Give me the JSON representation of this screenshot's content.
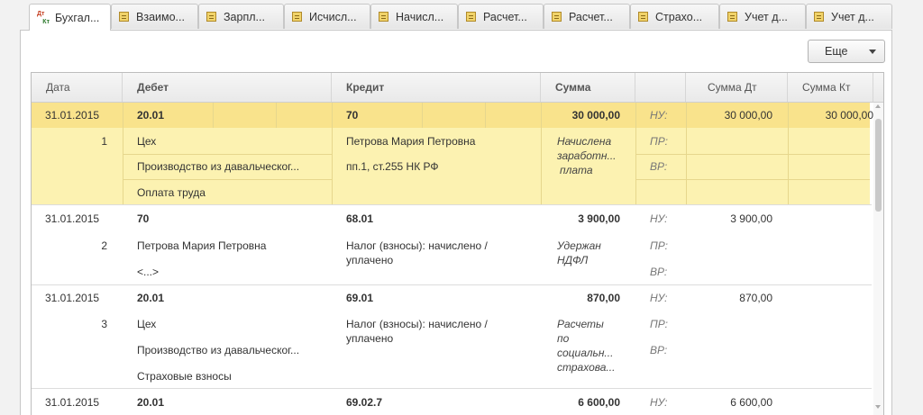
{
  "tabs": [
    {
      "label": "Бухгал..."
    },
    {
      "label": "Взаимо..."
    },
    {
      "label": "Зарпл..."
    },
    {
      "label": "Исчисл..."
    },
    {
      "label": "Начисл..."
    },
    {
      "label": "Расчет..."
    },
    {
      "label": "Расчет..."
    },
    {
      "label": "Страхо..."
    },
    {
      "label": "Учет д..."
    },
    {
      "label": "Учет д..."
    }
  ],
  "tab_icon_text": {
    "top": "Дт",
    "bottom": "Кт"
  },
  "toolbar": {
    "more_label": "Еще"
  },
  "columns": {
    "date": "Дата",
    "debit": "Дебет",
    "credit": "Кредит",
    "sum": "Сумма",
    "sum_dt": "Сумма Дт",
    "sum_kt": "Сумма Кт"
  },
  "rows": [
    {
      "date": "31.01.2015",
      "num": "1",
      "debit_account": "20.01",
      "debit_sub1": "Цех",
      "debit_sub2": "Производство из давальческог...",
      "debit_sub3": "Оплата труда",
      "credit_account": "70",
      "credit_sub1": "Петрова Мария Петровна",
      "credit_sub2": "пп.1, ст.255 НК РФ",
      "sum": "30 000,00",
      "content_lines": [
        "Начислена",
        "заработн...",
        "плата"
      ],
      "nu_label": "НУ:",
      "pr_label": "ПР:",
      "vr_label": "ВР:",
      "sum_dt_nu": "30 000,00",
      "sum_kt_nu": "30 000,00"
    },
    {
      "date": "31.01.2015",
      "num": "2",
      "debit_account": "70",
      "debit_sub1": "Петрова Мария Петровна",
      "debit_sub2": "<...>",
      "credit_account": "68.01",
      "credit_sub1": "Налог (взносы): начислено /",
      "credit_sub2": "уплачено",
      "sum": "3 900,00",
      "content_lines": [
        "Удержан",
        "НДФЛ"
      ],
      "nu_label": "НУ:",
      "pr_label": "ПР:",
      "vr_label": "ВР:",
      "sum_dt_nu": "3 900,00"
    },
    {
      "date": "31.01.2015",
      "num": "3",
      "debit_account": "20.01",
      "debit_sub1": "Цех",
      "debit_sub2": "Производство из давальческог...",
      "debit_sub3": "Страховые взносы",
      "credit_account": "69.01",
      "credit_sub1": "Налог (взносы): начислено /",
      "credit_sub2": "уплачено",
      "sum": "870,00",
      "content_lines": [
        "Расчеты",
        "по",
        "социальн...",
        "страхова..."
      ],
      "nu_label": "НУ:",
      "pr_label": "ПР:",
      "vr_label": "ВР:",
      "sum_dt_nu": "870,00"
    },
    {
      "date": "31.01.2015",
      "debit_account": "20.01",
      "credit_account": "69.02.7",
      "sum": "6 600,00",
      "nu_label": "НУ:",
      "sum_dt_nu": "6 600,00"
    }
  ],
  "colors": {
    "selected_row": "#fcf2b1",
    "selected_band": "#f9e38c",
    "header_bg": "#eeeeee"
  }
}
